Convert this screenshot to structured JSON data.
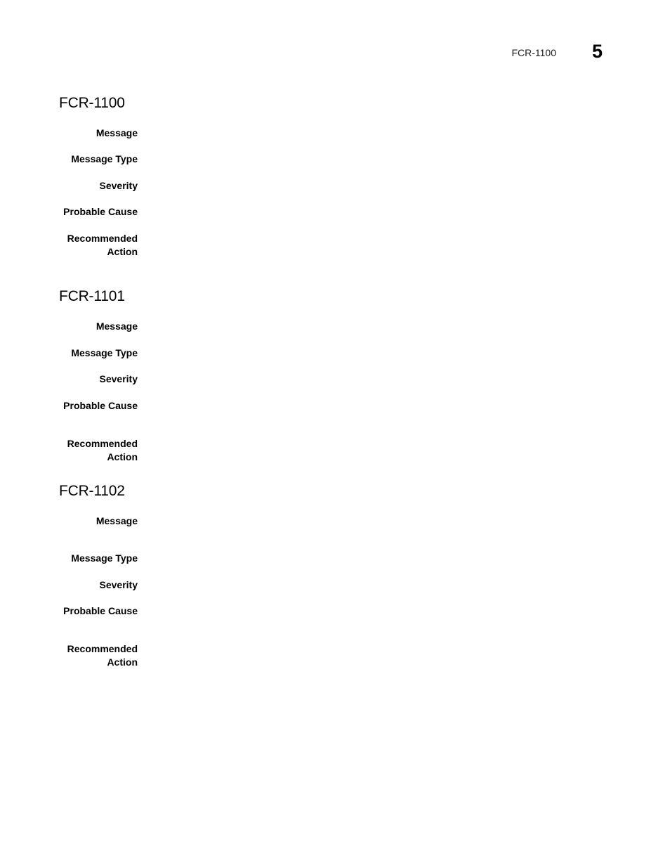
{
  "header": {
    "running_title": "FCR-1100",
    "chapter_number": "5"
  },
  "sections": [
    {
      "title": "FCR-1100",
      "fields": [
        {
          "label": "Message",
          "value": ""
        },
        {
          "label": "Message Type",
          "value": ""
        },
        {
          "label": "Severity",
          "value": ""
        },
        {
          "label": "Probable Cause",
          "value": ""
        },
        {
          "label_line1": "Recommended",
          "label_line2": "Action",
          "value": ""
        }
      ]
    },
    {
      "title": "FCR-1101",
      "fields": [
        {
          "label": "Message",
          "value": ""
        },
        {
          "label": "Message Type",
          "value": ""
        },
        {
          "label": "Severity",
          "value": ""
        },
        {
          "label": "Probable Cause",
          "value": ""
        },
        {
          "label_line1": "Recommended",
          "label_line2": "Action",
          "value": ""
        }
      ]
    },
    {
      "title": "FCR-1102",
      "fields": [
        {
          "label": "Message",
          "value": ""
        },
        {
          "label": "Message Type",
          "value": ""
        },
        {
          "label": "Severity",
          "value": ""
        },
        {
          "label": "Probable Cause",
          "value": ""
        },
        {
          "label_line1": "Recommended",
          "label_line2": "Action",
          "value": ""
        }
      ]
    }
  ]
}
